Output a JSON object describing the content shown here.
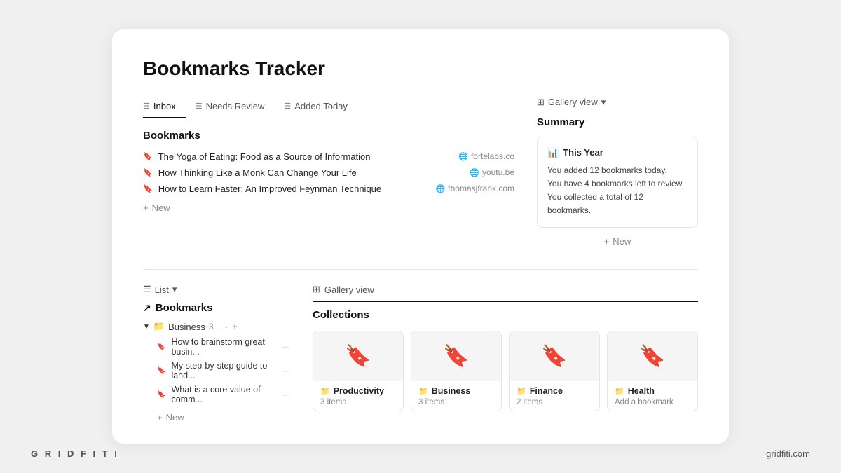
{
  "page": {
    "title": "Bookmarks Tracker",
    "background": "#f0f0f0"
  },
  "tabs": [
    {
      "label": "Inbox",
      "active": true
    },
    {
      "label": "Needs Review",
      "active": false
    },
    {
      "label": "Added Today",
      "active": false
    }
  ],
  "bookmarks_section": {
    "title": "Bookmarks",
    "items": [
      {
        "text": "The Yoga of Eating: Food as a Source of Information",
        "url": "fortelabs.co"
      },
      {
        "text": "How Thinking Like a Monk Can Change Your Life",
        "url": "youtu.be"
      },
      {
        "text": "How to Learn Faster: An Improved Feynman Technique",
        "url": "thomasjfrank.com"
      }
    ],
    "add_label": "New"
  },
  "gallery_view": {
    "label": "Gallery view"
  },
  "summary": {
    "title": "Summary",
    "card_title": "This Year",
    "lines": [
      "You added 12 bookmarks today.",
      "You have 4 bookmarks left to review.",
      "You collected a total of 12 bookmarks."
    ],
    "add_label": "New"
  },
  "list_view": {
    "label": "List"
  },
  "bottom_bookmarks": {
    "title": "Bookmarks",
    "folder": {
      "name": "Business",
      "count": "3"
    },
    "items": [
      "How to brainstorm great busin...",
      "My step-by-step guide to land...",
      "What is a core value of comm..."
    ],
    "add_label": "New"
  },
  "collections": {
    "title": "Collections",
    "gallery_label": "Gallery view",
    "items": [
      {
        "name": "Productivity",
        "count": "3 items"
      },
      {
        "name": "Business",
        "count": "3 items"
      },
      {
        "name": "Finance",
        "count": "2 items"
      },
      {
        "name": "Health",
        "count": "Add a bookmark"
      }
    ]
  },
  "footer": {
    "brand": "G R I D F I T I",
    "url": "gridfiti.com"
  }
}
